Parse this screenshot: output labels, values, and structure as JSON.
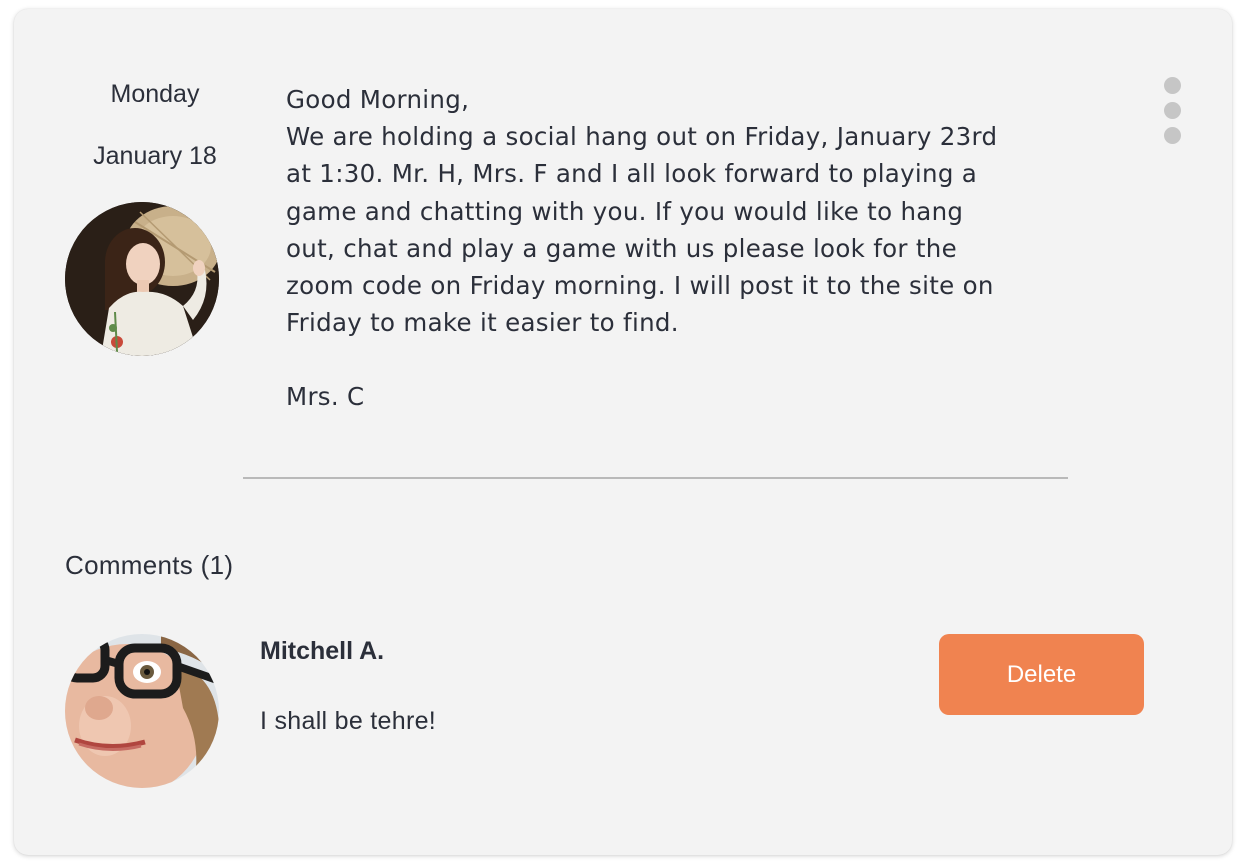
{
  "post": {
    "day": "Monday",
    "date": "January 18",
    "lines": [
      "Good Morning,",
      "We are holding a social hang out on Friday, January 23rd",
      "at 1:30.  Mr. H, Mrs. F and I all look forward to playing a",
      "game and chatting with you.  If you would like to hang",
      "out, chat and play a game with us please look for the",
      "zoom code on Friday morning.  I will post it to the site on",
      "Friday to make it easier to find."
    ],
    "signature": "Mrs. C",
    "menu_icon": "more-vertical-icon"
  },
  "comments": {
    "heading": "Comments (1)",
    "items": [
      {
        "author": "Mitchell A.",
        "text": "I shall be tehre!",
        "delete_label": "Delete"
      }
    ]
  },
  "colors": {
    "card_background": "#f3f3f3",
    "text": "#2b2f3a",
    "divider": "#b9b9b9",
    "menu_dots": "#c6c6c6",
    "delete_button": "#f08350",
    "delete_text": "#ffffff"
  }
}
